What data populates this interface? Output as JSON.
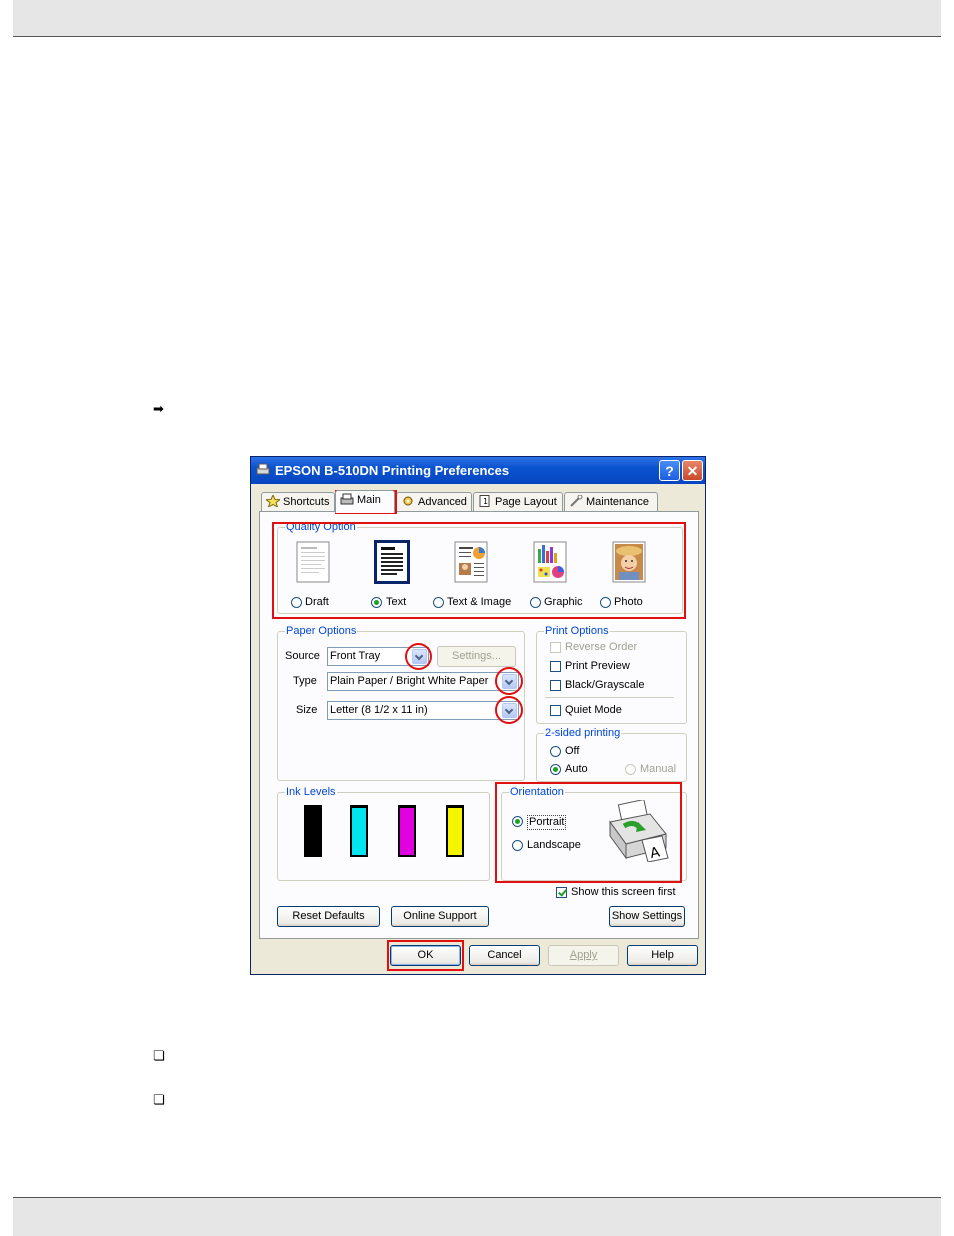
{
  "window": {
    "title": "EPSON B-510DN Printing Preferences",
    "help_glyph": "?",
    "close_glyph": "✕"
  },
  "tabs": [
    {
      "label": "Shortcuts"
    },
    {
      "label": "Main",
      "active": true
    },
    {
      "label": "Advanced"
    },
    {
      "label": "Page Layout"
    },
    {
      "label": "Maintenance"
    }
  ],
  "quality": {
    "title": "Quality Option",
    "options": [
      "Draft",
      "Text",
      "Text & Image",
      "Graphic",
      "Photo"
    ],
    "selected": "Text"
  },
  "paper": {
    "title": "Paper Options",
    "source_label": "Source",
    "source_value": "Front Tray",
    "settings_button": "Settings...",
    "type_label": "Type",
    "type_value": "Plain Paper / Bright White Paper",
    "size_label": "Size",
    "size_value": "Letter (8 1/2 x 11 in)"
  },
  "print_options": {
    "title": "Print Options",
    "reverse_order": "Reverse Order",
    "print_preview": "Print Preview",
    "black_grayscale": "Black/Grayscale",
    "quiet_mode": "Quiet Mode"
  },
  "two_sided": {
    "title": "2-sided printing",
    "off": "Off",
    "auto": "Auto",
    "manual": "Manual",
    "selected": "Auto"
  },
  "ink": {
    "title": "Ink Levels",
    "colors": [
      "#000000",
      "#00e5f0",
      "#e000e0",
      "#f5f500"
    ]
  },
  "orientation": {
    "title": "Orientation",
    "portrait": "Portrait",
    "landscape": "Landscape",
    "selected": "Portrait"
  },
  "show_first": "Show this screen first",
  "buttons": {
    "reset_defaults": "Reset Defaults",
    "online_support": "Online Support",
    "show_settings": "Show Settings",
    "ok": "OK",
    "cancel": "Cancel",
    "apply": "Apply",
    "help": "Help"
  },
  "page": {
    "arrow_glyph": "➡",
    "bullet_glyph": "❏"
  },
  "colors": {
    "highlight": "#e01010",
    "title_bar": "#0a53cf",
    "group_title": "#0046d5"
  }
}
